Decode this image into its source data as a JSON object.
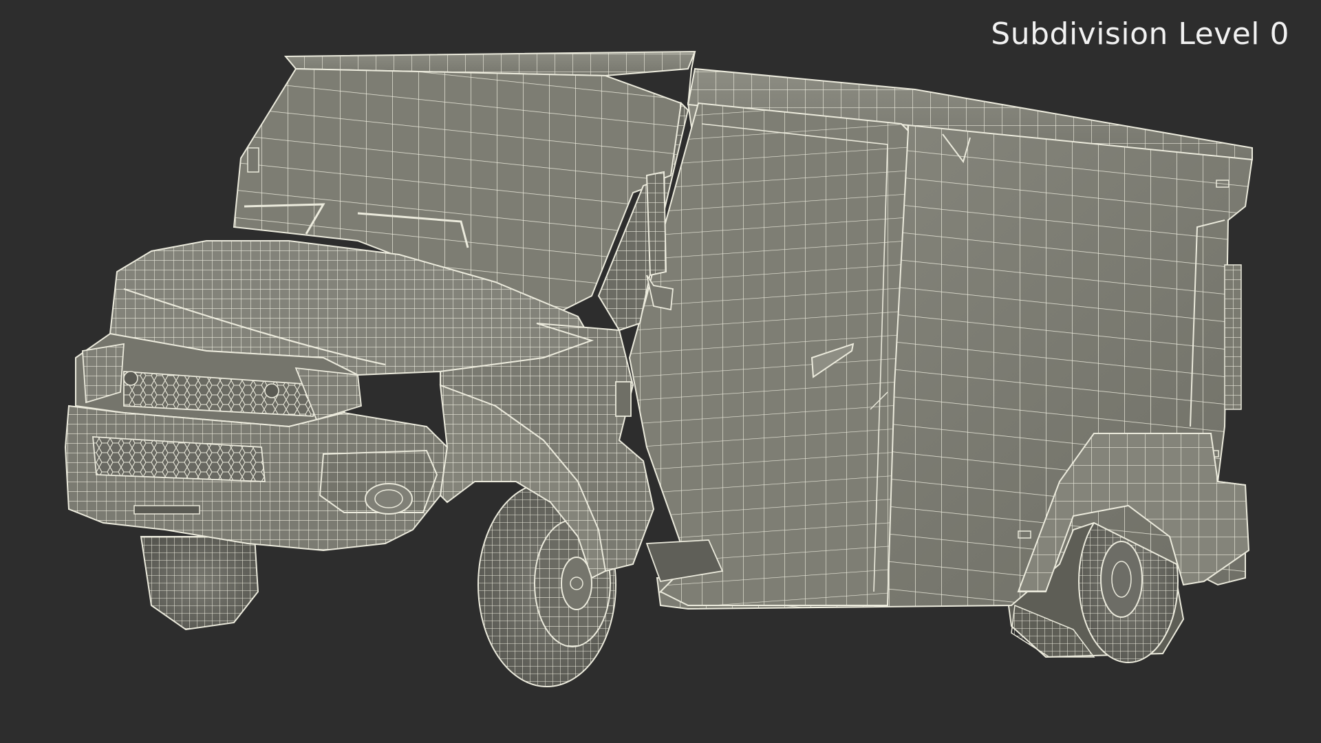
{
  "overlay": {
    "subdivision_label": "Subdivision Level 0"
  },
  "colors": {
    "background": "#2d2d2d",
    "surface": "#7c7c72",
    "surface_light": "#8f8f85",
    "surface_dark": "#5e5e56",
    "wire": "#ecebdd",
    "tire": "#6d6d66"
  }
}
